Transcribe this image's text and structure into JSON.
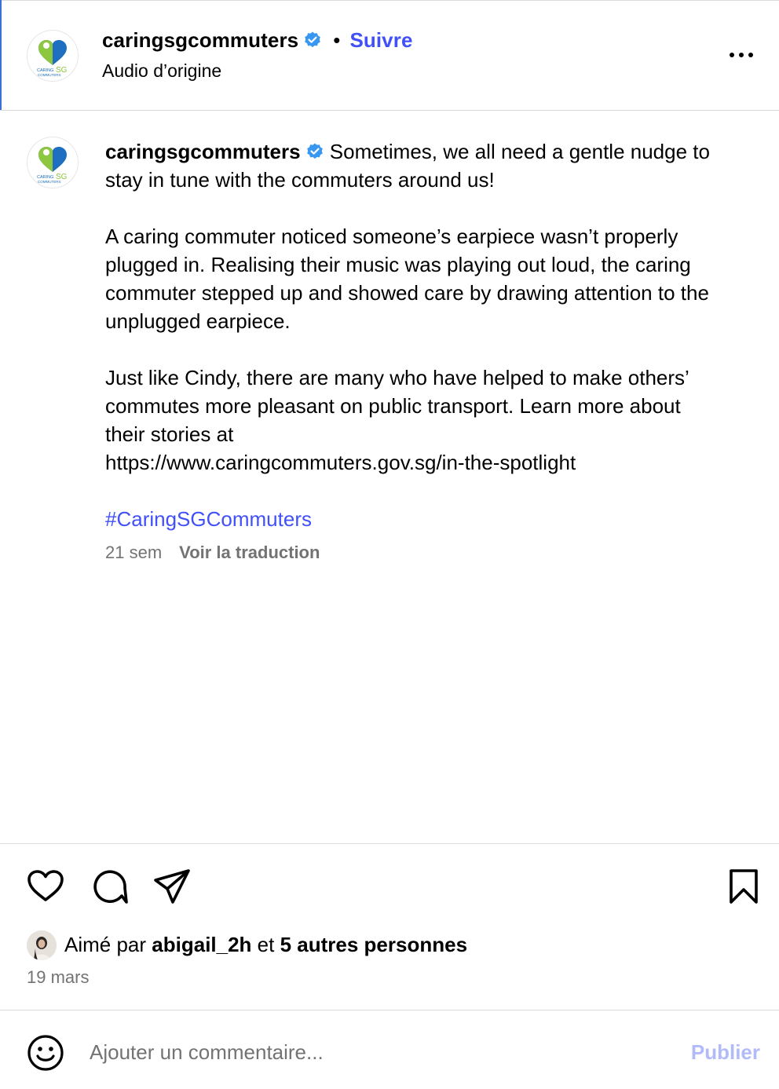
{
  "post": {
    "username": "caringsgcommuters",
    "separator": "•",
    "follow_label": "Suivre",
    "audio_label": "Audio d’origine",
    "logo_text_caring": "CARING",
    "logo_text_sg": "SG",
    "logo_text_commuters": "COMMUTERS"
  },
  "caption": {
    "username": "caringsgcommuters",
    "intro": "Sometimes, we all need a gentle nudge to stay in tune with the commuters around us!",
    "paragraph_2": "A caring commuter noticed someone’s earpiece wasn’t properly plugged in. Realising their music was playing out loud, the caring commuter stepped up and showed care by drawing attention to the unplugged earpiece.",
    "paragraph_3_line_1": "Just like Cindy, there are many who have helped to make others’ commutes more pleasant on public transport. Learn more about their stories at",
    "paragraph_3_url": "https://www.caringcommuters.gov.sg/in-the-spotlight",
    "hashtag": "#CaringSGCommuters",
    "age": "21 sem",
    "translate_label": "Voir la traduction"
  },
  "likes": {
    "prefix": "Aimé par",
    "user": "abigail_2h",
    "connector": "et",
    "others": "5 autres personnes"
  },
  "date": "19 mars",
  "comment": {
    "placeholder": "Ajouter un commentaire...",
    "publish_label": "Publier"
  },
  "colors": {
    "link_blue": "#4150f7",
    "verified_blue": "#3897f0",
    "muted_gray": "#737373",
    "publish_disabled": "#b2bbf9",
    "logo_heart_blue": "#1f6fc0",
    "logo_heart_green": "#8dc63f"
  },
  "icons": [
    "more-options-icon",
    "verified-badge-icon",
    "heart-icon",
    "comment-icon",
    "share-icon",
    "bookmark-icon",
    "emoji-icon"
  ]
}
